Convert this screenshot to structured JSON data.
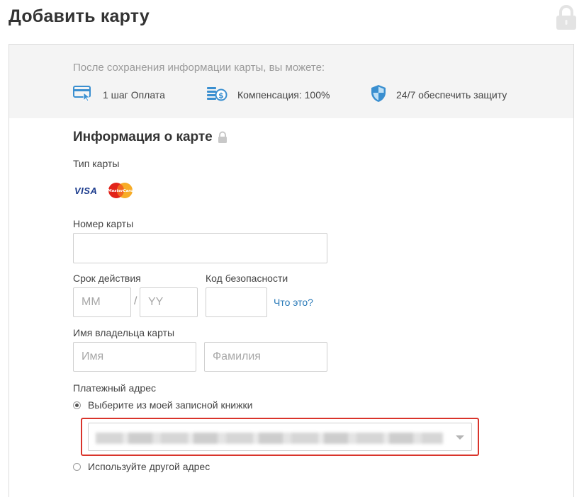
{
  "header": {
    "title": "Добавить карту",
    "lock_icon": "padlock-icon"
  },
  "benefits": {
    "intro": "После сохранения информации карты, вы можете:",
    "items": [
      {
        "icon": "card-click-icon",
        "label": "1 шаг Оплата"
      },
      {
        "icon": "coins-dollar-icon",
        "label": "Компенсация: 100%"
      },
      {
        "icon": "shield-icon",
        "label": "24/7 обеспечить защиту"
      }
    ]
  },
  "card_info": {
    "title": "Информация о карте",
    "card_type_label": "Тип карты",
    "card_types": [
      "VISA",
      "MasterCard"
    ],
    "card_number_label": "Номер карты",
    "card_number_value": "",
    "expiry_label": "Срок действия",
    "expiry_month_placeholder": "MM",
    "expiry_separator": "/",
    "expiry_year_placeholder": "YY",
    "cvv_label": "Код безопасности",
    "cvv_value": "",
    "cvv_help_link": "Что это?",
    "holder_label": "Имя владельца карты",
    "first_name_placeholder": "Имя",
    "last_name_placeholder": "Фамилия"
  },
  "billing": {
    "label": "Платежный адрес",
    "option_address_book": "Выберите из моей записной книжки",
    "option_address_book_selected": true,
    "option_other": "Используйте другой адрес",
    "option_other_selected": false
  },
  "colors": {
    "accent_link": "#2a7ab8",
    "highlight_border": "#d9342b",
    "benefit_icon_blue": "#3a8fd0",
    "muted_text": "#9a9a9a"
  }
}
